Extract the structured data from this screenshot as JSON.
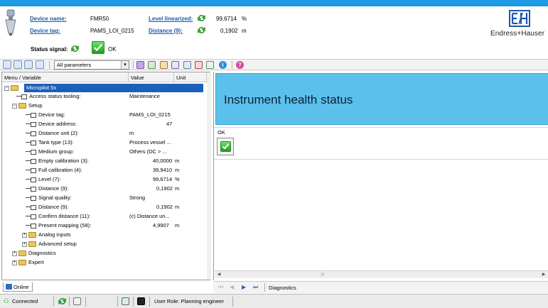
{
  "header": {
    "device_name_label": "Device name:",
    "device_name": "FMR50",
    "device_tag_label": "Device tag:",
    "device_tag": "PAMS_LOI_0215",
    "status_signal_label": "Status signal:",
    "status_signal_value": "OK",
    "level_label": "Level linearized:",
    "level_value": "99,6714",
    "level_unit": "%",
    "distance_label": "Distance (9):",
    "distance_value": "0,1902",
    "distance_unit": "m",
    "brand": "Endress+Hauser",
    "brand_color": "#1f58a8",
    "ok_color": "#1f9e1f"
  },
  "toolbar": {
    "filter_selected": "All parameters"
  },
  "tree": {
    "headers": {
      "menu": "Menu / Variable",
      "value": "Value",
      "unit": "Unit"
    },
    "rows": [
      {
        "label": "Micropilot 5x",
        "value": "",
        "unit": ""
      },
      {
        "label": "Access status tooling:",
        "value": "Maintenance",
        "unit": ""
      },
      {
        "label": "Setup",
        "value": "",
        "unit": ""
      },
      {
        "label": "Device tag:",
        "value": "PAMS_LOI_0215",
        "unit": ""
      },
      {
        "label": "Device address:",
        "value": "47",
        "unit": ""
      },
      {
        "label": "Distance unit (2):",
        "value": "m",
        "unit": ""
      },
      {
        "label": "Tank type (13):",
        "value": "Process vessel ...",
        "unit": ""
      },
      {
        "label": "Medium group:",
        "value": "Others (DC > ...",
        "unit": ""
      },
      {
        "label": "Empty calibration (3):",
        "value": "40,0000",
        "unit": "m"
      },
      {
        "label": "Full calibration (4):",
        "value": "39,9410",
        "unit": "m"
      },
      {
        "label": "Level (7):",
        "value": "99,6714",
        "unit": "%"
      },
      {
        "label": "Distance (9):",
        "value": "0,1902",
        "unit": "m"
      },
      {
        "label": "Signal quality:",
        "value": "Strong",
        "unit": ""
      },
      {
        "label": "Distance (9):",
        "value": "0,1902",
        "unit": "m"
      },
      {
        "label": "Confirm distance (11):",
        "value": "(c) Distance un...",
        "unit": ""
      },
      {
        "label": "Present mapping (58):",
        "value": "4,9907",
        "unit": "m"
      },
      {
        "label": "Analog inputs",
        "value": "",
        "unit": ""
      },
      {
        "label": "Advanced setup",
        "value": "",
        "unit": ""
      },
      {
        "label": "Diagnostics",
        "value": "",
        "unit": ""
      },
      {
        "label": "Expert",
        "value": "",
        "unit": ""
      }
    ]
  },
  "left_tab": {
    "label": "Online"
  },
  "right": {
    "title": "Instrument health status",
    "ok_label": "OK",
    "banner_color": "#5cc0ec"
  },
  "nav": {
    "label": "Diagnostics"
  },
  "statusbar": {
    "connection": "Connected",
    "user_role": "User Role: Planning engineer"
  }
}
